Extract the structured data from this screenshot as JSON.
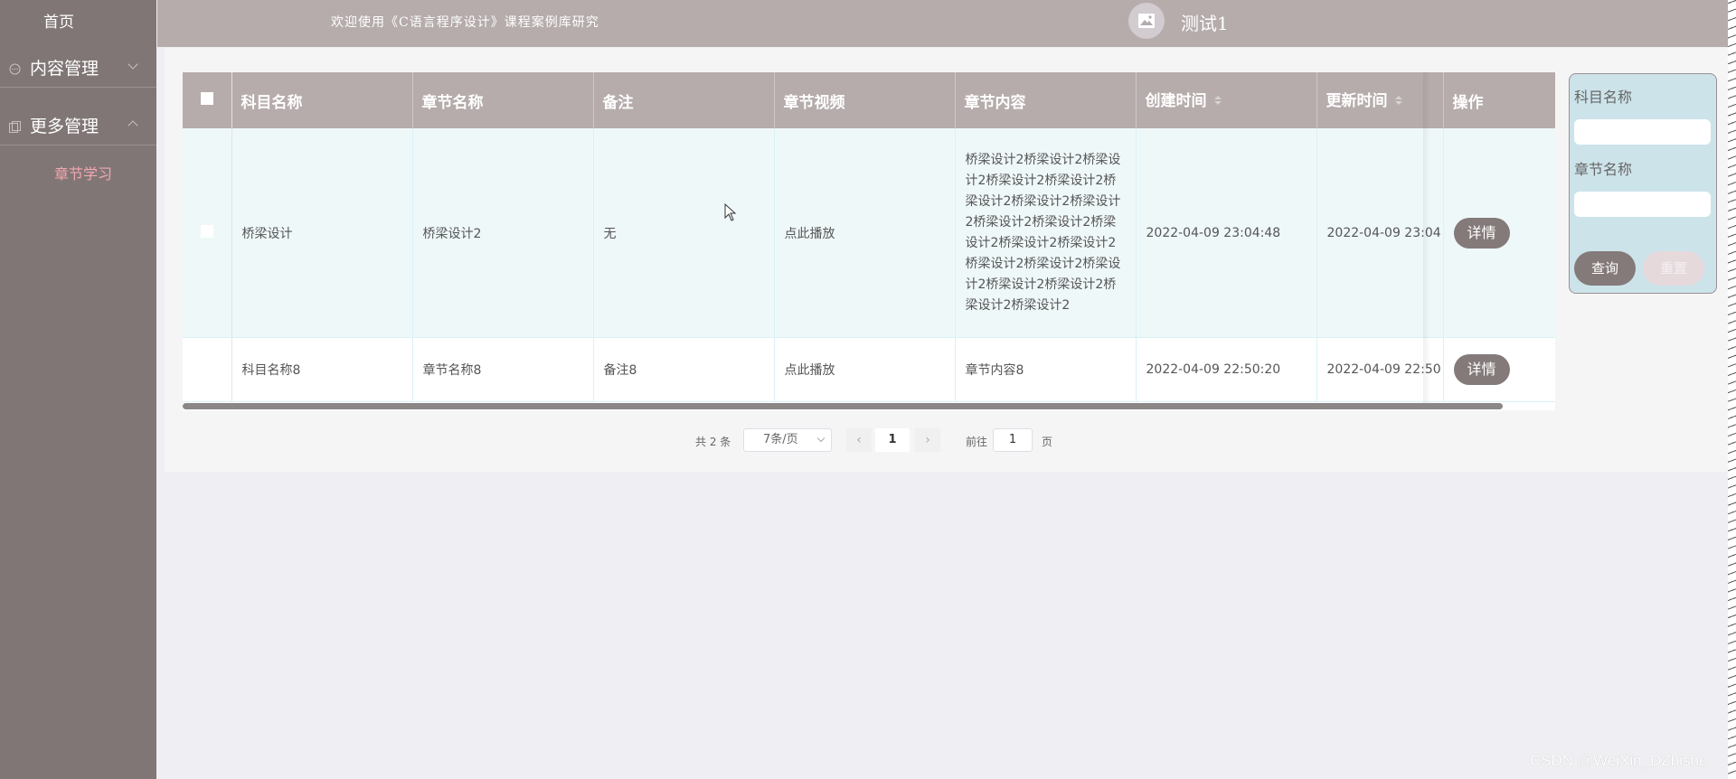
{
  "sidebar": {
    "home": "首页",
    "menus": [
      {
        "label": "内容管理",
        "expanded": false
      },
      {
        "label": "更多管理",
        "expanded": true
      }
    ],
    "sub_items": [
      "章节学习"
    ]
  },
  "header": {
    "welcome": "欢迎使用《C语言程序设计》课程案例库研究",
    "username": "测试1"
  },
  "table": {
    "columns": [
      "科目名称",
      "章节名称",
      "备注",
      "章节视频",
      "章节内容",
      "创建时间",
      "更新时间",
      "操作"
    ],
    "rows": [
      {
        "subject": "桥梁设计",
        "chapter": "桥梁设计2",
        "remark": "无",
        "video": "点此播放",
        "content": "桥梁设计2桥梁设计2桥梁设计2桥梁设计2桥梁设计2桥梁设计2桥梁设计2桥梁设计2桥梁设计2桥梁设计2桥梁设计2桥梁设计2桥梁设计2桥梁设计2桥梁设计2桥梁设计2桥梁设计2桥梁设计2桥梁设计2桥梁设计2",
        "created": "2022-04-09 23:04:48",
        "updated": "2022-04-09 23:04",
        "action": "详情"
      },
      {
        "subject": "科目名称8",
        "chapter": "章节名称8",
        "remark": "备注8",
        "video": "点此播放",
        "content": "章节内容8",
        "created": "2022-04-09 22:50:20",
        "updated": "2022-04-09 22:50",
        "action": "详情"
      }
    ]
  },
  "pagination": {
    "total": "共 2 条",
    "page_size": "7条/页",
    "current_page": "1",
    "goto_label": "前往",
    "goto_value": "1",
    "page_suffix": "页",
    "prev": "‹",
    "next": "›"
  },
  "search": {
    "field1_label": "科目名称",
    "field2_label": "章节名称",
    "query_button": "查询",
    "reset_button": "重置"
  },
  "watermark": "CSDN @WeiXin_DZbishe",
  "colors": {
    "sidebar": "#817676",
    "header": "#b6acac",
    "accent_pink": "#f2a7b0",
    "button": "#847a7a",
    "search_bg": "#cde3ea"
  }
}
